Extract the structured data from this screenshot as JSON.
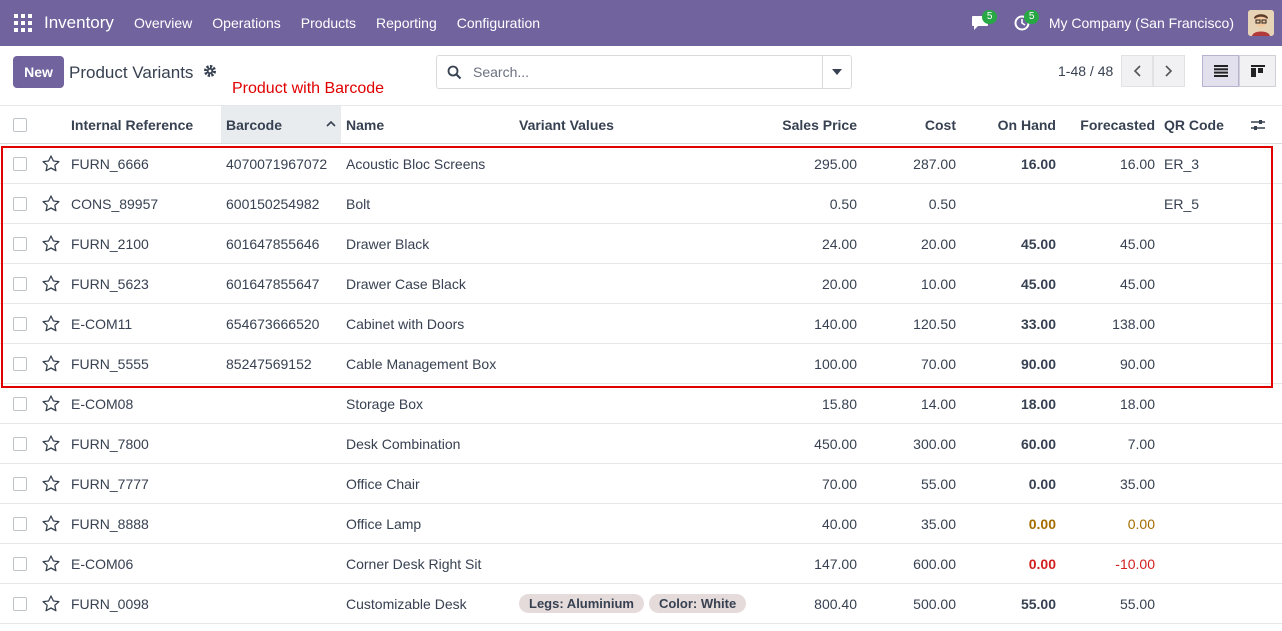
{
  "navbar": {
    "app_title": "Inventory",
    "menu": [
      "Overview",
      "Operations",
      "Products",
      "Reporting",
      "Configuration"
    ],
    "messages_badge": "5",
    "activities_badge": "5",
    "company": "My Company (San Francisco)"
  },
  "control_panel": {
    "new_label": "New",
    "title": "Product Variants",
    "annotation": "Product with Barcode",
    "search_placeholder": "Search...",
    "pager": "1-48 / 48"
  },
  "table": {
    "columns": [
      "Internal Reference",
      "Barcode",
      "Name",
      "Variant Values",
      "Sales Price",
      "Cost",
      "On Hand",
      "Forecasted",
      "QR Code"
    ],
    "rows": [
      {
        "ref": "FURN_6666",
        "barcode": "4070071967072",
        "name": "Acoustic Bloc Screens",
        "variants": [],
        "price": "295.00",
        "cost": "287.00",
        "onhand": "16.00",
        "forecast": "16.00",
        "qr": "ER_3",
        "status": ""
      },
      {
        "ref": "CONS_89957",
        "barcode": "600150254982",
        "name": "Bolt",
        "variants": [],
        "price": "0.50",
        "cost": "0.50",
        "onhand": "",
        "forecast": "",
        "qr": "ER_5",
        "status": ""
      },
      {
        "ref": "FURN_2100",
        "barcode": "601647855646",
        "name": "Drawer Black",
        "variants": [],
        "price": "24.00",
        "cost": "20.00",
        "onhand": "45.00",
        "forecast": "45.00",
        "qr": "",
        "status": ""
      },
      {
        "ref": "FURN_5623",
        "barcode": "601647855647",
        "name": "Drawer Case Black",
        "variants": [],
        "price": "20.00",
        "cost": "10.00",
        "onhand": "45.00",
        "forecast": "45.00",
        "qr": "",
        "status": ""
      },
      {
        "ref": "E-COM11",
        "barcode": "654673666520",
        "name": "Cabinet with Doors",
        "variants": [],
        "price": "140.00",
        "cost": "120.50",
        "onhand": "33.00",
        "forecast": "138.00",
        "qr": "",
        "status": ""
      },
      {
        "ref": "FURN_5555",
        "barcode": "85247569152",
        "name": "Cable Management Box",
        "variants": [],
        "price": "100.00",
        "cost": "70.00",
        "onhand": "90.00",
        "forecast": "90.00",
        "qr": "",
        "status": ""
      },
      {
        "ref": "E-COM08",
        "barcode": "",
        "name": "Storage Box",
        "variants": [],
        "price": "15.80",
        "cost": "14.00",
        "onhand": "18.00",
        "forecast": "18.00",
        "qr": "",
        "status": ""
      },
      {
        "ref": "FURN_7800",
        "barcode": "",
        "name": "Desk Combination",
        "variants": [],
        "price": "450.00",
        "cost": "300.00",
        "onhand": "60.00",
        "forecast": "7.00",
        "qr": "",
        "status": ""
      },
      {
        "ref": "FURN_7777",
        "barcode": "",
        "name": "Office Chair",
        "variants": [],
        "price": "70.00",
        "cost": "55.00",
        "onhand": "0.00",
        "forecast": "35.00",
        "qr": "",
        "status": ""
      },
      {
        "ref": "FURN_8888",
        "barcode": "",
        "name": "Office Lamp",
        "variants": [],
        "price": "40.00",
        "cost": "35.00",
        "onhand": "0.00",
        "forecast": "0.00",
        "qr": "",
        "status": "warn"
      },
      {
        "ref": "E-COM06",
        "barcode": "",
        "name": "Corner Desk Right Sit",
        "variants": [],
        "price": "147.00",
        "cost": "600.00",
        "onhand": "0.00",
        "forecast": "-10.00",
        "qr": "",
        "status": "danger"
      },
      {
        "ref": "FURN_0098",
        "barcode": "",
        "name": "Customizable Desk",
        "variants": [
          "Legs: Aluminium",
          "Color: White"
        ],
        "price": "800.40",
        "cost": "500.00",
        "onhand": "55.00",
        "forecast": "55.00",
        "qr": "",
        "status": ""
      }
    ]
  },
  "colors": {
    "brand": "#71639e",
    "warning": "#a36d00",
    "danger": "#d21f1f",
    "annotation": "#e00000"
  }
}
